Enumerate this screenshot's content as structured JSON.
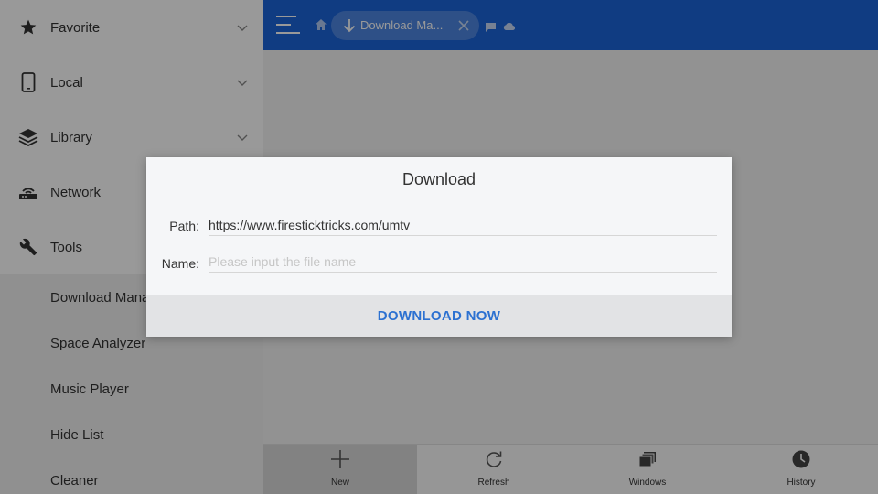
{
  "sidebar": {
    "items": [
      {
        "label": "Favorite",
        "icon": "star-icon"
      },
      {
        "label": "Local",
        "icon": "phone-icon"
      },
      {
        "label": "Library",
        "icon": "layers-icon"
      },
      {
        "label": "Network",
        "icon": "router-icon"
      },
      {
        "label": "Tools",
        "icon": "wrench-icon"
      }
    ],
    "tools_subitems": [
      {
        "label": "Download Manager"
      },
      {
        "label": "Space Analyzer"
      },
      {
        "label": "Music Player"
      },
      {
        "label": "Hide List"
      },
      {
        "label": "Cleaner"
      }
    ]
  },
  "topbar": {
    "tab_label": "Download Ma...",
    "color": "#1c64d9"
  },
  "bottombar": {
    "buttons": [
      {
        "label": "New",
        "icon": "plus-icon"
      },
      {
        "label": "Refresh",
        "icon": "refresh-icon"
      },
      {
        "label": "Windows",
        "icon": "windows-icon"
      },
      {
        "label": "History",
        "icon": "clock-icon"
      }
    ]
  },
  "dialog": {
    "title": "Download",
    "path_label": "Path:",
    "path_value": "https://www.firesticktricks.com/umtv",
    "name_label": "Name:",
    "name_placeholder": "Please input the file name",
    "name_value": "",
    "action_label": "DOWNLOAD NOW",
    "action_color": "#2c71d1"
  }
}
